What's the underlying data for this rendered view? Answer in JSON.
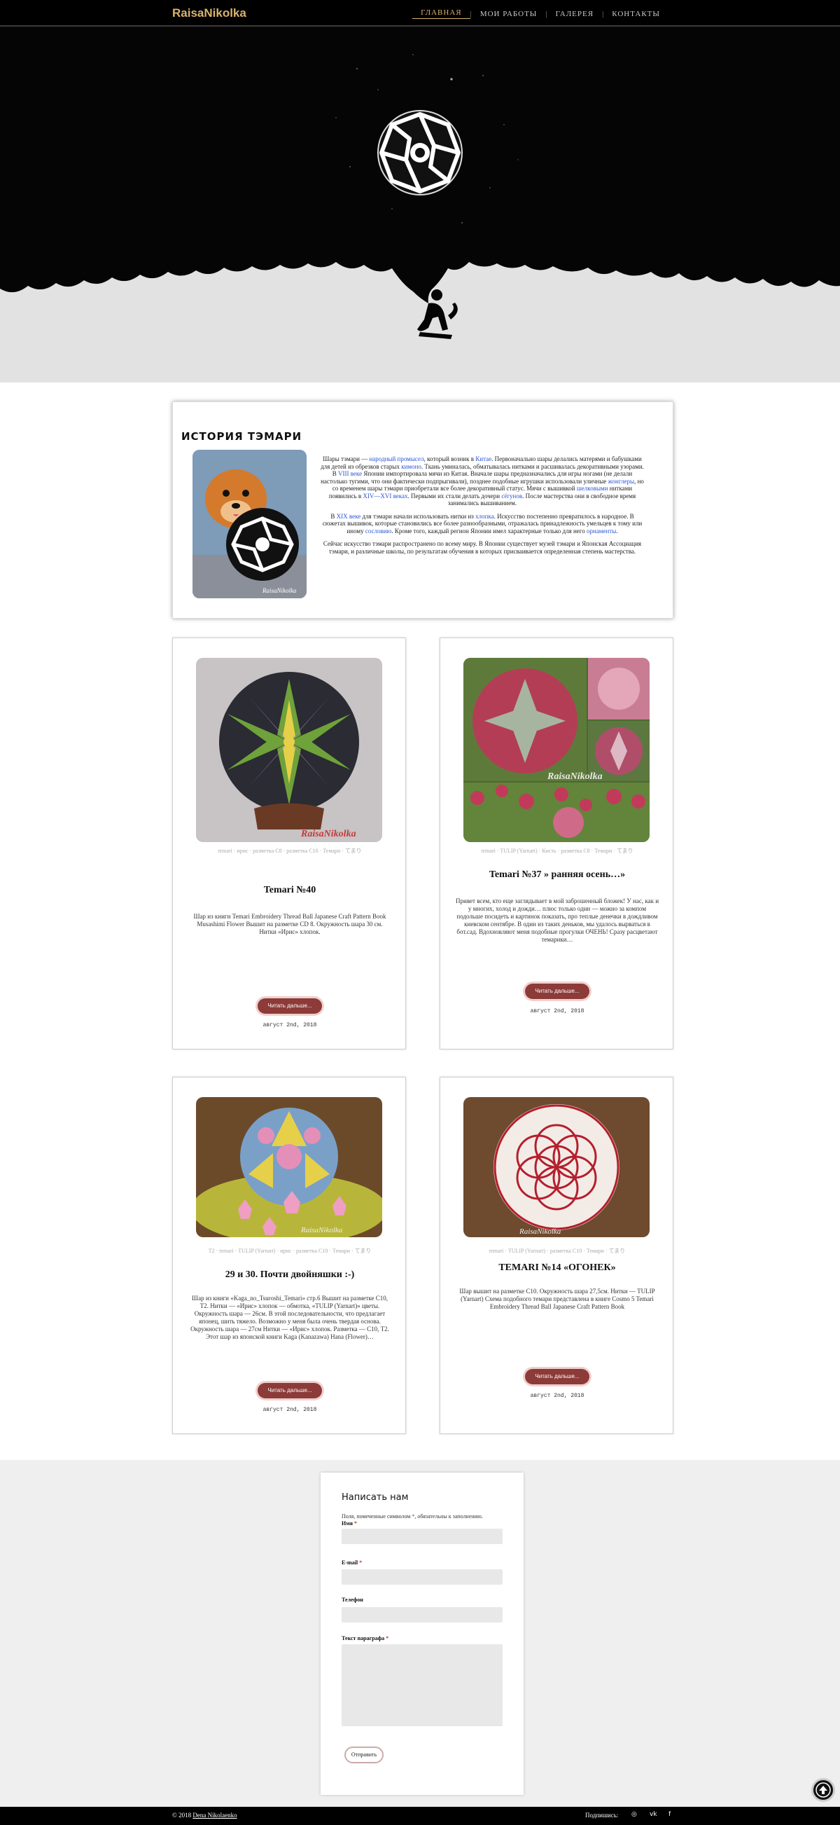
{
  "header": {
    "logo": "RaisaNikolka",
    "nav": [
      {
        "label": "ГЛАВНАЯ",
        "active": true
      },
      {
        "label": "МОИ РАБОТЫ",
        "active": false
      },
      {
        "label": "ГАЛЕРЕЯ",
        "active": false
      },
      {
        "label": "КОНТАКТЫ",
        "active": false
      }
    ],
    "separator": "|"
  },
  "history": {
    "title": "ИСТОРИЯ ТЭМАРИ",
    "photo_watermark": "RaisaNikolka",
    "p1_a": "Шары тэмари — ",
    "p1_link1": "народный промысел",
    "p1_b": ", который возник в ",
    "p1_link2": "Китае",
    "p1_c": ". Первоначально шары делались матерями и бабушками для детей из обрезков старых ",
    "p1_link3": "кимоно",
    "p1_d": ". Ткань уминалась, обматывалась нитками и расшивалась декоративными узорами. В ",
    "p1_link4": "VIII веке",
    "p1_e": " Японии импортировала мячи из Китая. Вначале шары предназначались для игры ногами (не делали настолько тугими, что они фактически подпрыгивали), позднее подобные игрушки использовали уличные ",
    "p1_link5": "жонглеры",
    "p1_f": ", но со временем шары тэмари приобретали все более декоративный статус. Мячи с вышивкой ",
    "p1_link6": "шелковыми",
    "p1_g": " нитками появились в ",
    "p1_link7": "XIV—XVI веках",
    "p1_h": ". Первыми их стали делать дочери ",
    "p1_link8": "сёгунов",
    "p1_i": ". После мастерства они в свободное время занимались вышиванием.",
    "p2_a": "В ",
    "p2_link1": "XIX веке",
    "p2_b": " для тэмари начали использовать нитки из ",
    "p2_link2": "хлопка",
    "p2_c": ". Искусство постепенно превратилось в народное. В сюжетах вышивок, которые становились все более разнообразными, отражалась принадлежность умельцев к тому или иному ",
    "p2_link3": "сословию",
    "p2_d": ". Кроме того, каждый регион Японии имел характерные только для него ",
    "p2_link4": "орнаменты",
    "p2_e": ".",
    "p3": "Сейчас искусство тэмари распространено по всему миру. В Японии существует музей тэмари и Японская Ассоциация тэмари, и различные школы, по результатам обучения в которых присваивается определенная степень мастерства."
  },
  "posts": [
    {
      "tags": "temari · ирис · разметка C8 · разметка C10 · Темари · てまり",
      "title": "Temari №40",
      "excerpt": "Шар из книги Temari Embroidery Thread Ball Japanese Craft Pattern Book Musashimi Flower Вышит на разметке CD 8. Окружность шара 30 см. Нитки «Ирис» хлопок.",
      "watermark": "RaisaNikolka",
      "button": "Читать дальше...",
      "date": "август 2nd, 2018"
    },
    {
      "tags": "temari · TULIP (Yarnart) · Кисть · разметка C8 · Темари · てまり",
      "title": "Temari №37 » ранняя осень…»",
      "excerpt": "Привет всем, кто еще заглядывает в мой заброшенный бложек! У нас, как и у многих, холод и дожди… плюс только один — можно за компом подольше посидеть и картинок показать, про теплые денечки в дождливом киевском сентябре. В один из таких деньков, мы удалось вырваться в бот.сад. Вдохновляют меня подобные прогулки ОЧЕНЬ! Сразу расцветают темарики…",
      "watermark": "RaisaNikolka",
      "button": "Читать дальше...",
      "date": "август 2nd, 2018"
    },
    {
      "tags": "T2 · temari · TULIP (Yarnart) · ирис · разметка C10 · Темари · てまり",
      "title": "29 и 30. Почти двойняшки :-)",
      "excerpt": "Шар из книги «Kaga_no_Tsuroshi_Temari» стр.6 Вышит на разметке С10, Т2. Нитки — «Ирис» хлопок — обмотка, «TULIP (Yarnart)» цветы. Окружность шара — 26см. В этой последовательности, что предлагает японец, шить тяжело. Возможно у меня была очень твердая основа. Окружность шара — 27см Нитки — «Ирис» хлопок. Разметка — С10, Т2. Этот шар из японской книги Kaga (Kanazawa) Hana (Flower)…",
      "watermark": "RaisaNikolka",
      "button": "Читать дальше...",
      "date": "август 2nd, 2018"
    },
    {
      "tags": "temari · TULIP (Yarnart) · разметка C10 · Темари · てまり",
      "title": "TEMARI №14 «ОГОНЕК»",
      "excerpt": "Шар вышит на разметке C10. Окружность шара 27,5см. Нитки — TULIP (Yarnart) Схема подобного темари представлена в книге Cosmo 5 Temari Embroidery Thread Ball Japanese Craft Pattern Book",
      "watermark": "RaisaNikolka",
      "button": "Читать дальше...",
      "date": "август 2nd, 2018"
    }
  ],
  "contact": {
    "title": "Написать нам",
    "note": "Поля, помеченные символом",
    "note_star": "*",
    "note_end": ", обязательны к заполнению.",
    "fields": [
      {
        "label": "Имя",
        "required": true
      },
      {
        "label": "E-mail",
        "required": true
      },
      {
        "label": "Телефон",
        "required": false
      },
      {
        "label": "Текст параграфа",
        "required": true
      }
    ],
    "submit": "Отправить"
  },
  "footer": {
    "copyright": "© 2018",
    "author": "Dena Nikolaenko",
    "share_label": "Подпишись:",
    "social": [
      "instagram-icon",
      "vk-icon",
      "facebook-icon"
    ],
    "social_glyphs": [
      "◎",
      "vk",
      "f"
    ]
  },
  "colors": {
    "accent_gold": "#d9b36a",
    "button_red": "#8c3b38",
    "link_blue": "#2a55d6"
  }
}
